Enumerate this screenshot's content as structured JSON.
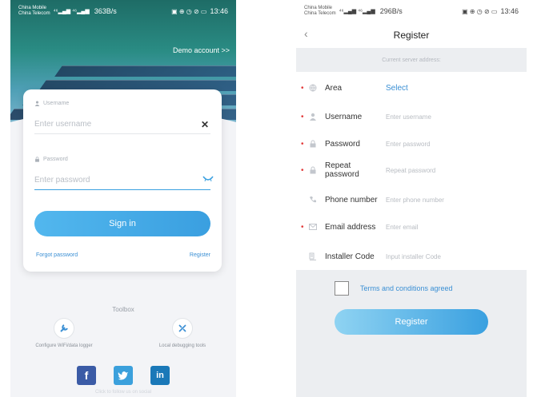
{
  "login": {
    "status": {
      "carrier_line1": "China Mobile",
      "carrier_line2": "China Telecom",
      "signal": "⁴⁶▂▄▆ ⁴⁶▂▄▆",
      "speed": "363B/s",
      "icons": "▣ ⊕ ◷ ⊘ ▭",
      "time": "13:46"
    },
    "demo_account": "Demo account >>",
    "username_label": "Username",
    "username_placeholder": "Enter username",
    "password_label": "Password",
    "password_placeholder": "Enter password",
    "clear_symbol": "✕",
    "sign_in": "Sign in",
    "forgot_password": "Forgot password",
    "register": "Register",
    "toolbox": {
      "title": "Toolbox",
      "tools": [
        {
          "label": "Configure WiFi/data logger",
          "icon": "wrench-icon"
        },
        {
          "label": "Local debugging tools",
          "icon": "debug-tool-icon"
        }
      ]
    },
    "socials": [
      {
        "name": "facebook",
        "glyph": "f",
        "color": "#3b5ba6"
      },
      {
        "name": "twitter",
        "glyph": "🐦",
        "color": "#3ba0dc"
      },
      {
        "name": "linkedin",
        "glyph": "in",
        "color": "#1a78b8"
      }
    ],
    "footer_text": "Click to follow us on social"
  },
  "register": {
    "status": {
      "carrier_line1": "China Mobile",
      "carrier_line2": "China Telecom",
      "signal": "⁴⁶▂▄▆ ⁴⁶▂▄▆",
      "speed": "296B/s",
      "icons": "▣ ⊕ ◷ ⊘ ▭",
      "time": "13:46"
    },
    "back_symbol": "‹",
    "title": "Register",
    "server_address": "Current server address:",
    "fields": [
      {
        "key": "area",
        "required": true,
        "label": "Area",
        "icon": "globe-icon",
        "select": "Select"
      },
      {
        "key": "username",
        "required": true,
        "label": "Username",
        "icon": "user-icon",
        "placeholder": "Enter username"
      },
      {
        "key": "password",
        "required": true,
        "label": "Password",
        "icon": "lock-icon",
        "placeholder": "Enter password"
      },
      {
        "key": "repeat_password",
        "required": true,
        "label_line1": "Repeat",
        "label_line2": "password",
        "icon": "lock-icon",
        "placeholder": "Repeat password"
      },
      {
        "key": "phone",
        "required": false,
        "label": "Phone number",
        "icon": "phone-icon",
        "placeholder": "Enter phone number"
      },
      {
        "key": "email",
        "required": true,
        "label": "Email address",
        "icon": "mail-icon",
        "placeholder": "Enter email"
      },
      {
        "key": "installer",
        "required": false,
        "label": "Installer Code",
        "icon": "installer-icon",
        "placeholder": "Input installer Code"
      }
    ],
    "required_mark": "•",
    "terms": "Terms and conditions agreed",
    "register_button": "Register"
  }
}
